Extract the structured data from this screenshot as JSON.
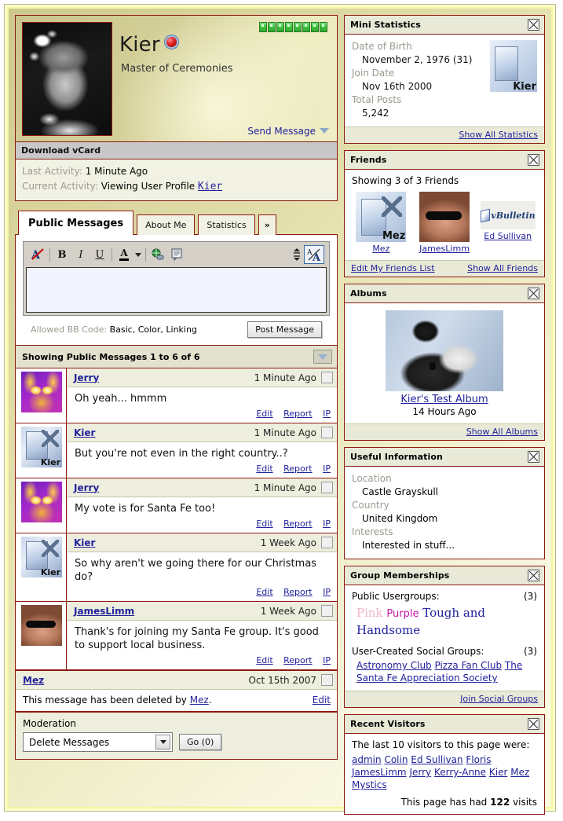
{
  "profile": {
    "username": "Kier",
    "user_title": "Master of Ceremonies",
    "send_message": "Send Message",
    "reputation_blocks": 8,
    "online_indicator": "online-dot",
    "avatar_alt": "Kier avatar photo"
  },
  "vcard": {
    "header": "Download vCard",
    "last_activity_label": "Last Activity:",
    "last_activity_value": "1 Minute Ago",
    "current_activity_label": "Current Activity:",
    "current_activity_value": "Viewing User Profile",
    "current_activity_link": "Kier"
  },
  "tabs": [
    {
      "label": "Public Messages",
      "active": true
    },
    {
      "label": "About Me",
      "active": false
    },
    {
      "label": "Statistics",
      "active": false
    },
    {
      "label": "»",
      "active": false
    }
  ],
  "editor": {
    "tools": [
      "remove-formatting-icon",
      "bold-icon",
      "italic-icon",
      "underline-icon",
      "font-color-icon",
      "insert-link-icon",
      "insert-quote-icon",
      "resize-box-icon",
      "toggle-wysiwyg-icon"
    ],
    "textarea_value": "",
    "bbcode_label": "Allowed BB Code:",
    "bbcode_value": "Basic, Color, Linking",
    "post_button": "Post Message"
  },
  "message_list": {
    "header": "Showing Public Messages 1 to 6 of 6",
    "messages": [
      {
        "author": "Jerry",
        "time": "1 Minute Ago",
        "text": "Oh yeah... hmmm",
        "avatar": "av-jerry",
        "actions": [
          "Edit",
          "Report",
          "IP"
        ],
        "deleted": false
      },
      {
        "author": "Kier",
        "time": "1 Minute Ago",
        "text": "But you're not even in the right country..?",
        "avatar": "av-kier",
        "actions": [
          "Edit",
          "Report",
          "IP"
        ],
        "deleted": false
      },
      {
        "author": "Jerry",
        "time": "1 Minute Ago",
        "text": "My vote is for Santa Fe too!",
        "avatar": "av-jerry",
        "actions": [
          "Edit",
          "Report",
          "IP"
        ],
        "deleted": false
      },
      {
        "author": "Kier",
        "time": "1 Week Ago",
        "text": "So why aren't we going there for our Christmas do?",
        "avatar": "av-kier",
        "actions": [
          "Edit",
          "Report",
          "IP"
        ],
        "deleted": false
      },
      {
        "author": "JamesLimm",
        "time": "1 Week Ago",
        "text": "Thank's for joining my Santa Fe group. It's good to support local business.",
        "avatar": "av-james",
        "actions": [
          "Edit",
          "Report",
          "IP"
        ],
        "deleted": false
      },
      {
        "author": "Mez",
        "time": "Oct 15th 2007",
        "deleted": true,
        "deleted_prefix": "This message has been deleted by ",
        "deleted_by": "Mez",
        "deleted_suffix": ".",
        "edit_label": "Edit"
      }
    ]
  },
  "moderation": {
    "label": "Moderation",
    "selected_option": "Delete Messages",
    "go_button": "Go (0)"
  },
  "mini_statistics": {
    "title": "Mini Statistics",
    "rows": [
      {
        "label": "Date of Birth",
        "value": "November 2, 1976 (31)"
      },
      {
        "label": "Join Date",
        "value": "Nov 16th 2000"
      },
      {
        "label": "Total Posts",
        "value": "5,242"
      }
    ],
    "thumb_alt": "Kier logo thumbnail",
    "footer_link": "Show All Statistics"
  },
  "friends": {
    "title": "Friends",
    "showing": "Showing 3 of 3 Friends",
    "items": [
      {
        "name": "Mez",
        "thumb": "ph-mez"
      },
      {
        "name": "JamesLimm",
        "thumb": "ph-james"
      },
      {
        "name": "Ed Sullivan",
        "thumb": "ph-vb"
      }
    ],
    "edit_link": "Edit My Friends List",
    "show_all_link": "Show All Friends"
  },
  "albums": {
    "title": "Albums",
    "album_name": "Kier's Test Album",
    "album_date": "14 Hours Ago",
    "footer_link": "Show All Albums"
  },
  "useful_information": {
    "title": "Useful Information",
    "rows": [
      {
        "label": "Location",
        "value": "Castle Grayskull"
      },
      {
        "label": "Country",
        "value": "United Kingdom"
      },
      {
        "label": "Interests",
        "value": "Interested in stuff..."
      }
    ]
  },
  "group_memberships": {
    "title": "Group Memberships",
    "public_label": "Public Usergroups:",
    "public_count": "(3)",
    "public_groups": [
      {
        "name": "Pink",
        "color": "#f2b6c6"
      },
      {
        "name": "Purple",
        "color": "#c317a0"
      },
      {
        "name": "Tough and Handsome",
        "color": "#20209c"
      }
    ],
    "social_label": "User-Created Social Groups:",
    "social_count": "(3)",
    "social_groups": [
      "Astronomy Club",
      "Pizza Fan Club",
      "The Santa Fe Appreciation Society"
    ],
    "footer_link": "Join Social Groups"
  },
  "recent_visitors": {
    "title": "Recent Visitors",
    "lead": "The last 10 visitors to this page were:",
    "visitors": [
      "admin",
      "Colin",
      "Ed Sullivan",
      "Floris",
      "JamesLimm",
      "Jerry",
      "Kerry-Anne",
      "Kier",
      "Mez",
      "Mystics"
    ],
    "visits_prefix": "This page has had",
    "visits_count": "122",
    "visits_suffix": "visits"
  },
  "colors": {
    "border_red": "#8b1a11",
    "link_blue": "#22229c",
    "panel_head": "#e9e9d8",
    "page_bg": "#ffffc8"
  }
}
